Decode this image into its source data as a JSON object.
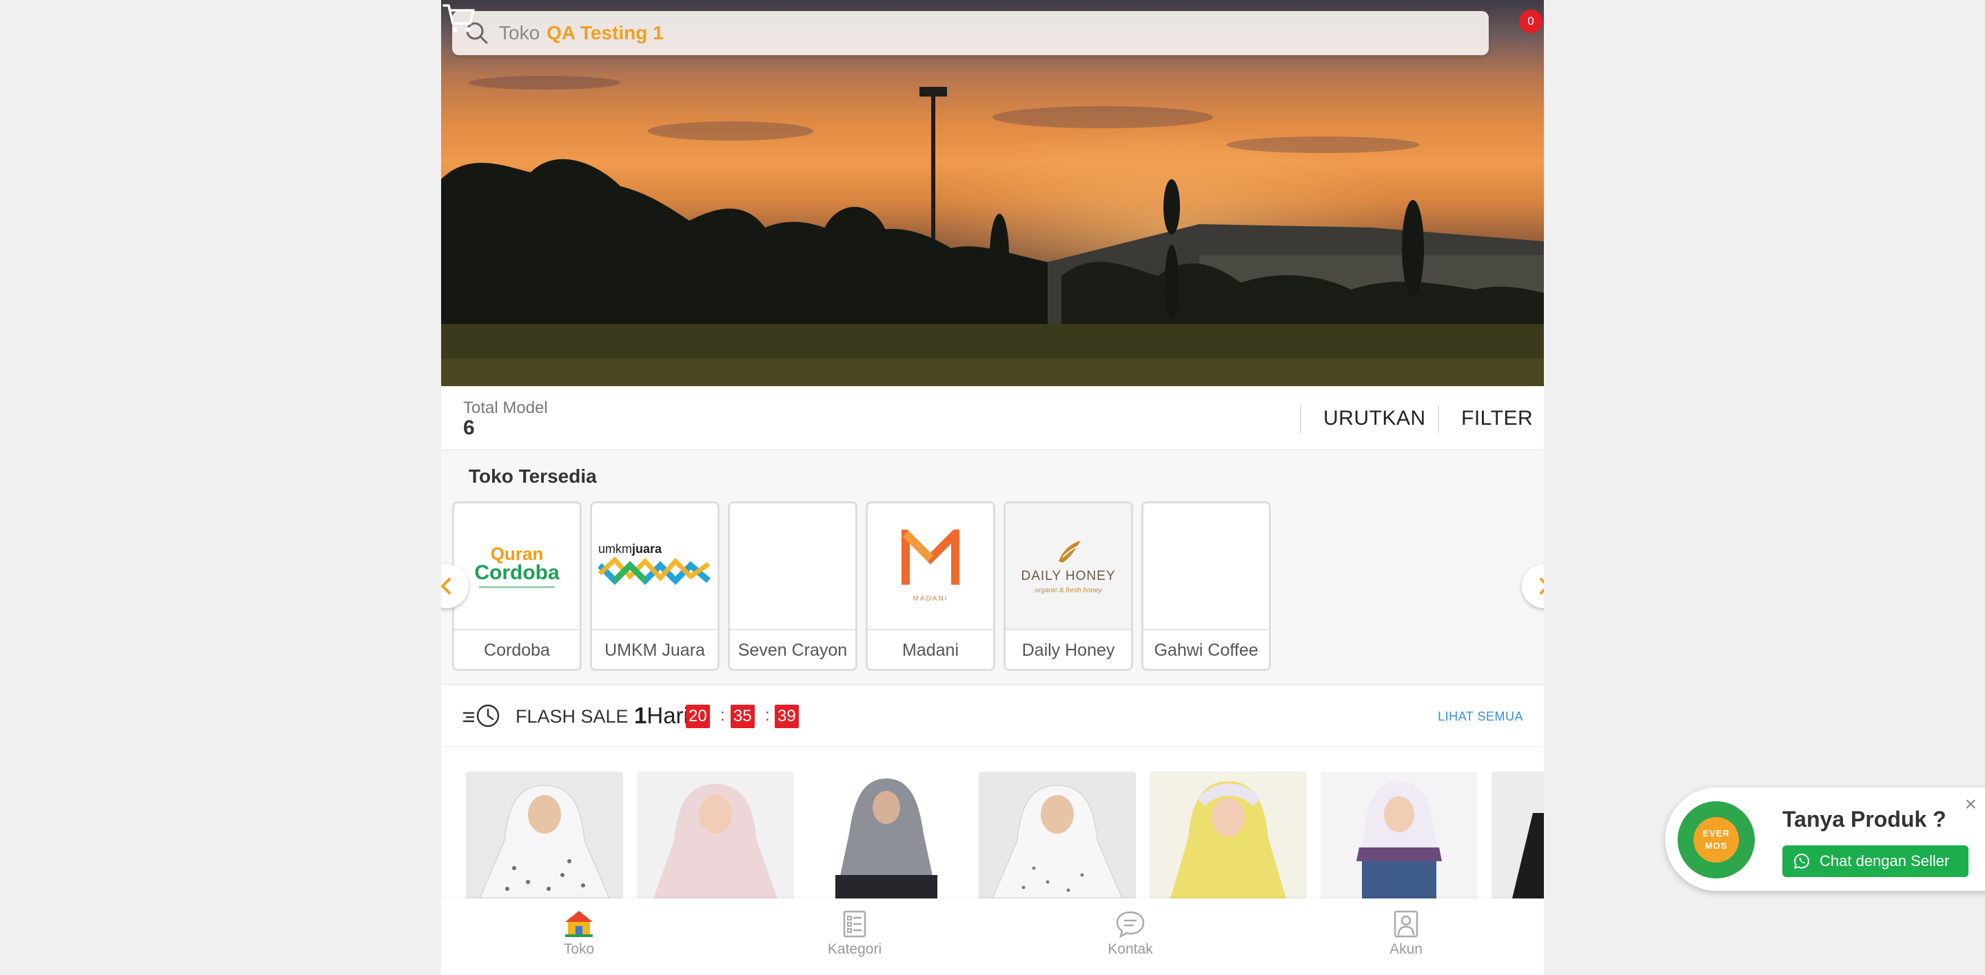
{
  "header": {
    "search_prefix": "Toko",
    "store_name": "QA Testing 1",
    "cart_count": "0"
  },
  "summary": {
    "total_label": "Total Model",
    "total_value": "6",
    "sort_label": "URUTKAN",
    "filter_label": "FILTER"
  },
  "stores": {
    "title": "Toko Tersedia",
    "items": [
      {
        "name": "Cordoba",
        "logo": "quran-cordoba-logo"
      },
      {
        "name": "UMKM Juara",
        "logo": "umkm-juara-logo"
      },
      {
        "name": "Seven Crayon",
        "logo": "none"
      },
      {
        "name": "Madani",
        "logo": "madani-logo"
      },
      {
        "name": "Daily Honey",
        "logo": "daily-honey-logo"
      },
      {
        "name": "Gahwi Coffee",
        "logo": "none"
      }
    ],
    "logo_text": {
      "cordoba_top": "Quran",
      "cordoba_bottom": "Cordoba",
      "umkm_small": "umkm",
      "umkm_bold": "juara",
      "madani_small": "MADANI",
      "honey_main": "DAILY HONEY",
      "honey_sub": "organic & fresh honey"
    }
  },
  "flash_sale": {
    "label": "FLASH SALE",
    "days": "1",
    "days_unit": "Hari",
    "hours": "20",
    "minutes": "35",
    "seconds": "39",
    "see_all": "LIHAT SEMUA"
  },
  "nav": {
    "items": [
      {
        "label": "Toko",
        "icon": "store-icon",
        "active": true
      },
      {
        "label": "Kategori",
        "icon": "category-icon",
        "active": false
      },
      {
        "label": "Kontak",
        "icon": "chat-bubble-icon",
        "active": false
      },
      {
        "label": "Akun",
        "icon": "user-icon",
        "active": false
      }
    ]
  },
  "chat_popup": {
    "logo_line1": "EVER",
    "logo_line2": "MOS",
    "question": "Tanya Produk ?",
    "button": "Chat dengan Seller",
    "close": "×"
  },
  "colors": {
    "accent": "#f0a020",
    "badge_red": "#e41e26",
    "whatsapp_green": "#1cad4c",
    "link_blue": "#3a8fd6"
  }
}
